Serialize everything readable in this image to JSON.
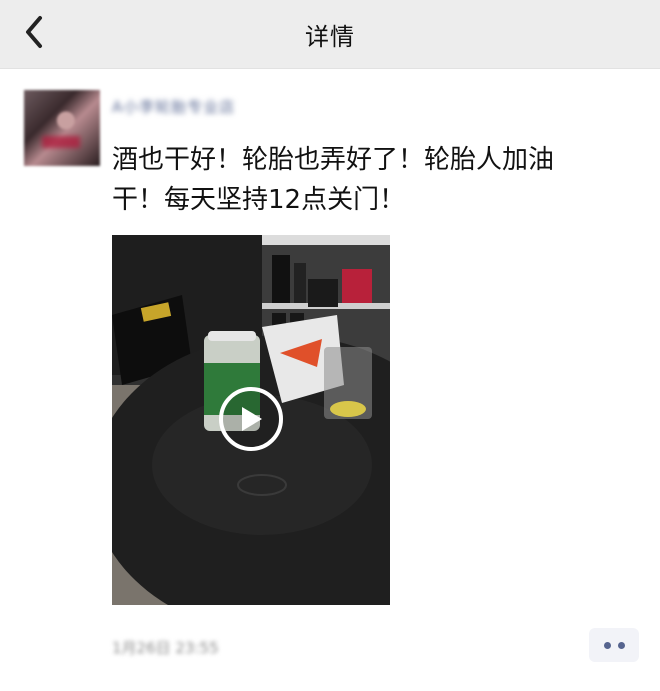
{
  "header": {
    "title": "详情"
  },
  "post": {
    "author": "A小李轮胎专业店",
    "text_line1": "酒也干好！轮胎也弄好了！轮胎人加油",
    "text_line2": "干！每天坚持12点关门！",
    "time": "1月26日 23:55"
  },
  "icons": {
    "back": "chevron-left-icon",
    "play": "play-icon",
    "more": "more-dots-icon"
  },
  "colors": {
    "header_bg": "#ededed",
    "link": "#576b95",
    "text": "#111111"
  }
}
